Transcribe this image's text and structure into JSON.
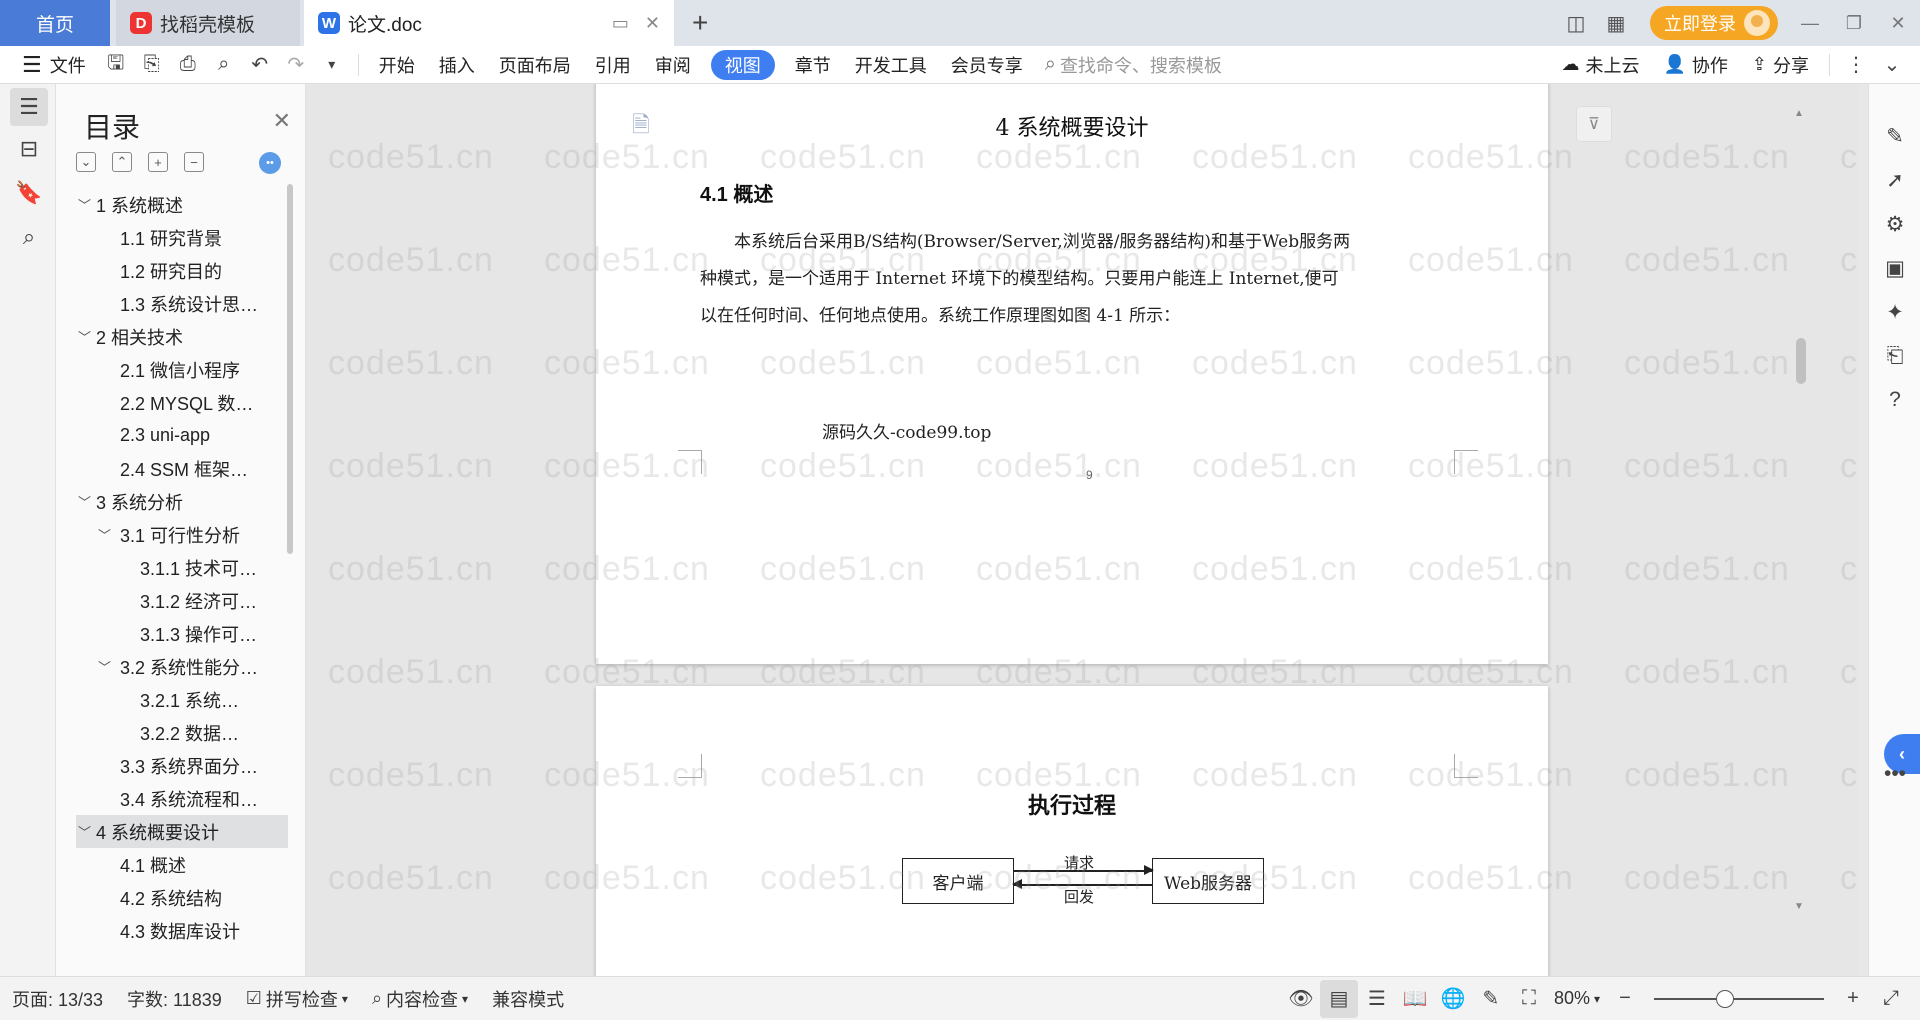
{
  "tabs": {
    "home": "首页",
    "template": "找稻壳模板",
    "doc": "论文.doc",
    "add": "+"
  },
  "titlebar": {
    "login": "立即登录"
  },
  "menu": {
    "file": "文件",
    "items": [
      "开始",
      "插入",
      "页面布局",
      "引用",
      "审阅",
      "视图",
      "章节",
      "开发工具",
      "会员专享"
    ],
    "active": "视图",
    "search_placeholder": "查找命令、搜索模板",
    "cloud": "未上云",
    "collab": "协作",
    "share": "分享"
  },
  "toc": {
    "title": "目录",
    "items": [
      {
        "text": "1 系统概述",
        "level": 1,
        "caret": "expanded"
      },
      {
        "text": "1.1  研究背景",
        "level": 2,
        "caret": ""
      },
      {
        "text": "1.2 研究目的",
        "level": 2,
        "caret": ""
      },
      {
        "text": "1.3 系统设计思…",
        "level": 2,
        "caret": ""
      },
      {
        "text": "2 相关技术",
        "level": 1,
        "caret": "expanded"
      },
      {
        "text": "2.1 微信小程序",
        "level": 2,
        "caret": ""
      },
      {
        "text": "2.2 MYSQL 数…",
        "level": 2,
        "caret": ""
      },
      {
        "text": "2.3 uni-app",
        "level": 2,
        "caret": ""
      },
      {
        "text": "2.4 SSM 框架…",
        "level": 2,
        "caret": ""
      },
      {
        "text": "3 系统分析",
        "level": 1,
        "caret": "expanded"
      },
      {
        "text": "3.1 可行性分析",
        "level": 2,
        "caret": "expanded"
      },
      {
        "text": "3.1.1 技术可…",
        "level": 3,
        "caret": ""
      },
      {
        "text": "3.1.2 经济可…",
        "level": 3,
        "caret": ""
      },
      {
        "text": "3.1.3 操作可…",
        "level": 3,
        "caret": ""
      },
      {
        "text": "3.2 系统性能分…",
        "level": 2,
        "caret": "expanded"
      },
      {
        "text": "3.2.1  系统…",
        "level": 3,
        "caret": ""
      },
      {
        "text": "3.2.2  数据…",
        "level": 3,
        "caret": ""
      },
      {
        "text": "3.3 系统界面分…",
        "level": 2,
        "caret": ""
      },
      {
        "text": "3.4 系统流程和…",
        "level": 2,
        "caret": ""
      },
      {
        "text": "4 系统概要设计",
        "level": 1,
        "caret": "expanded",
        "selected": true
      },
      {
        "text": "4.1 概述",
        "level": 2,
        "caret": ""
      },
      {
        "text": "4.2 系统结构",
        "level": 2,
        "caret": ""
      },
      {
        "text": "4.3 数据库设计",
        "level": 2,
        "caret": ""
      }
    ]
  },
  "document": {
    "chapter_title": "4 系统概要设计",
    "section_title": "4.1 概述",
    "paragraph_lines": [
      "本系统后台采用B/S结构(Browser/Server,浏览器/服务器结构)和基于Web服务两",
      "种模式，是一个适用于 Internet 环境下的模型结构。只要用户能连上 Internet,便可",
      "以在任何时间、任何地点使用。系统工作原理图如图 4-1 所示："
    ],
    "source_note": "源码久久-code99.top",
    "page_number": "9",
    "diagram": {
      "title": "执行过程",
      "client": "客户端",
      "server": "Web服务器",
      "request": "请求",
      "reply": "回发"
    },
    "watermark": "code51.cn"
  },
  "statusbar": {
    "page": "页面: 13/33",
    "words": "字数: 11839",
    "spell": "拼写检查",
    "content_check": "内容检查",
    "compat": "兼容模式",
    "zoom": "80%",
    "zoom_level": 0.42
  }
}
